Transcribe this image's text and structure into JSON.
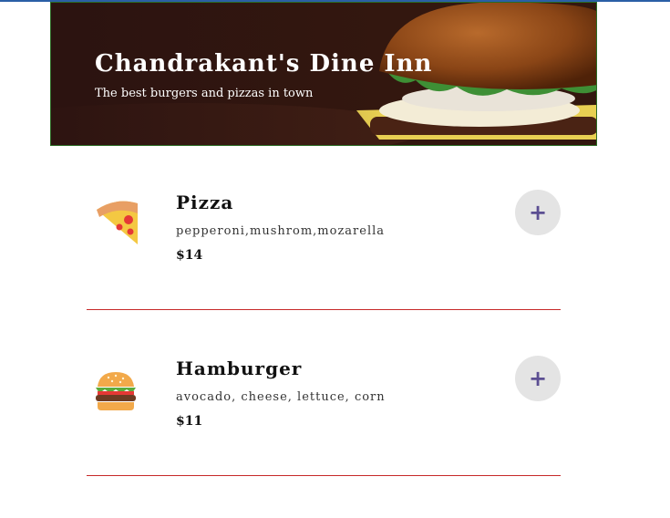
{
  "header": {
    "title": "Chandrakant's Dine Inn",
    "subtitle": "The best burgers and pizzas in town"
  },
  "menu": {
    "items": [
      {
        "icon": "pizza-slice-icon",
        "name": "Pizza",
        "description": "pepperoni,mushrom,mozarella",
        "price": "$14",
        "add_label": "+"
      },
      {
        "icon": "hamburger-icon",
        "name": "Hamburger",
        "description": "avocado, cheese, lettuce, corn",
        "price": "$11",
        "add_label": "+"
      }
    ]
  },
  "colors": {
    "top_bar": "#2b5fa6",
    "divider": "#c62828",
    "add_button_bg": "#e4e4e4",
    "plus_color": "#5b4e92"
  }
}
